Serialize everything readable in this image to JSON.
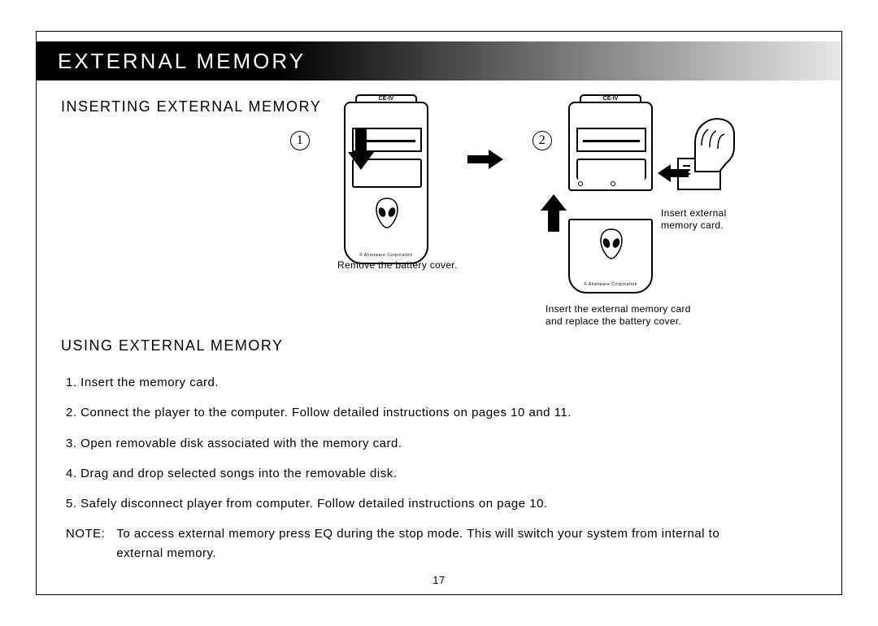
{
  "header": {
    "title": "EXTERNAL MEMORY"
  },
  "section1": {
    "title": "INSERTING EXTERNAL MEMORY",
    "step1_num": "1",
    "step2_num": "2",
    "device_label": "CE-IV",
    "corp_label": "© Alienware Corporation",
    "caption1": "Remove the battery cover.",
    "caption2a": "Insert external",
    "caption2b": "memory card.",
    "caption3a": "Insert the external memory card",
    "caption3b": "and replace the battery cover."
  },
  "section2": {
    "title": "USING EXTERNAL MEMORY",
    "steps": [
      "1. Insert the memory card.",
      "2. Connect the player to the computer. Follow detailed instructions on pages 10 and 11.",
      "3. Open removable disk associated with the memory card.",
      "4. Drag and drop selected songs into the removable disk.",
      "5. Safely disconnect player from computer. Follow detailed instructions on page 10."
    ],
    "note_label": "NOTE:",
    "note_text": "To access external memory press EQ during the stop mode. This will switch your system from internal to external memory."
  },
  "page_number": "17"
}
